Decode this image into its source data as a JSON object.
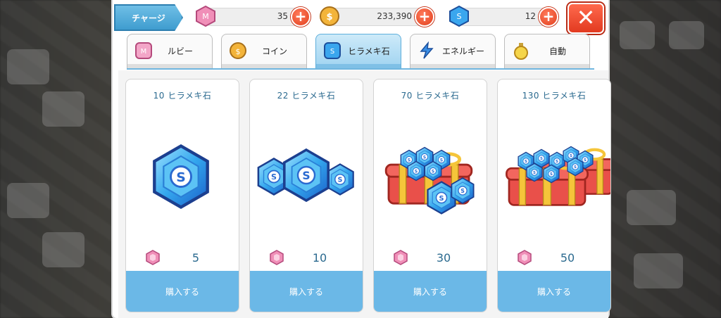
{
  "header": {
    "charge_label": "チャージ",
    "ruby_value": "35",
    "coin_value": "233,390",
    "gem_value": "12"
  },
  "tabs": [
    {
      "label": "ルビー",
      "icon": "ruby-icon",
      "active": false
    },
    {
      "label": "コイン",
      "icon": "coin-icon",
      "active": false
    },
    {
      "label": "ヒラメキ石",
      "icon": "gem-icon",
      "active": true
    },
    {
      "label": "エネルギー",
      "icon": "energy-icon",
      "active": false
    },
    {
      "label": "自動",
      "icon": "potion-icon",
      "active": false
    }
  ],
  "items": [
    {
      "name": "10 ヒラメキ石",
      "price": "5",
      "buy_label": "購入する",
      "art": "single-gem"
    },
    {
      "name": "22 ヒラメキ石",
      "price": "10",
      "buy_label": "購入する",
      "art": "three-gems"
    },
    {
      "name": "70 ヒラメキ石",
      "price": "30",
      "buy_label": "購入する",
      "art": "gift-box-gems"
    },
    {
      "name": "130 ヒラメキ石",
      "price": "50",
      "buy_label": "購入する",
      "art": "two-gift-boxes-gems"
    }
  ],
  "colors": {
    "accent": "#6bb8e7",
    "title_text": "#2b6a8f",
    "close_red": "#e23a20"
  }
}
